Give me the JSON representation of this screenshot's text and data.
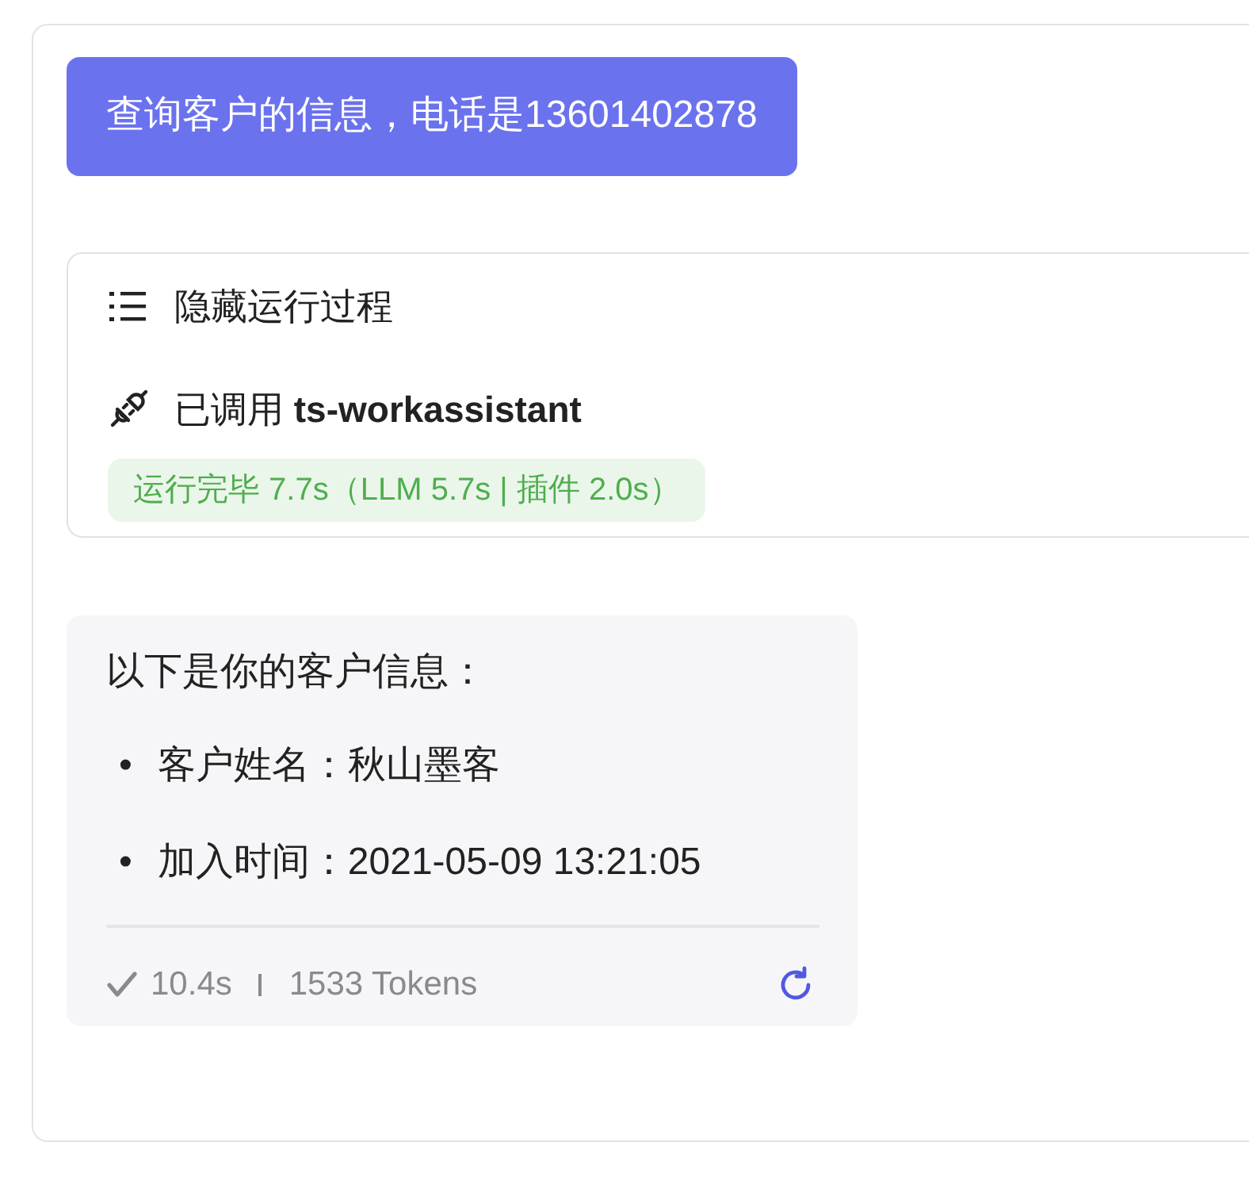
{
  "user_message": {
    "text": "查询客户的信息，电话是13601402878"
  },
  "process": {
    "toggle_label": "隐藏运行过程",
    "plugin_call": "已调用 **ts-workassistant**",
    "status": "运行完毕 7.7s（LLM 5.7s | 插件 2.0s）"
  },
  "answer": {
    "intro": "以下是你的客户信息：",
    "items": [
      {
        "bullet": "•",
        "text": "客户姓名：秋山墨客"
      },
      {
        "bullet": "•",
        "text": "加入时间：2021-05-09 13:21:05"
      }
    ],
    "duration": "10.4s",
    "tokens": "1533 Tokens"
  }
}
